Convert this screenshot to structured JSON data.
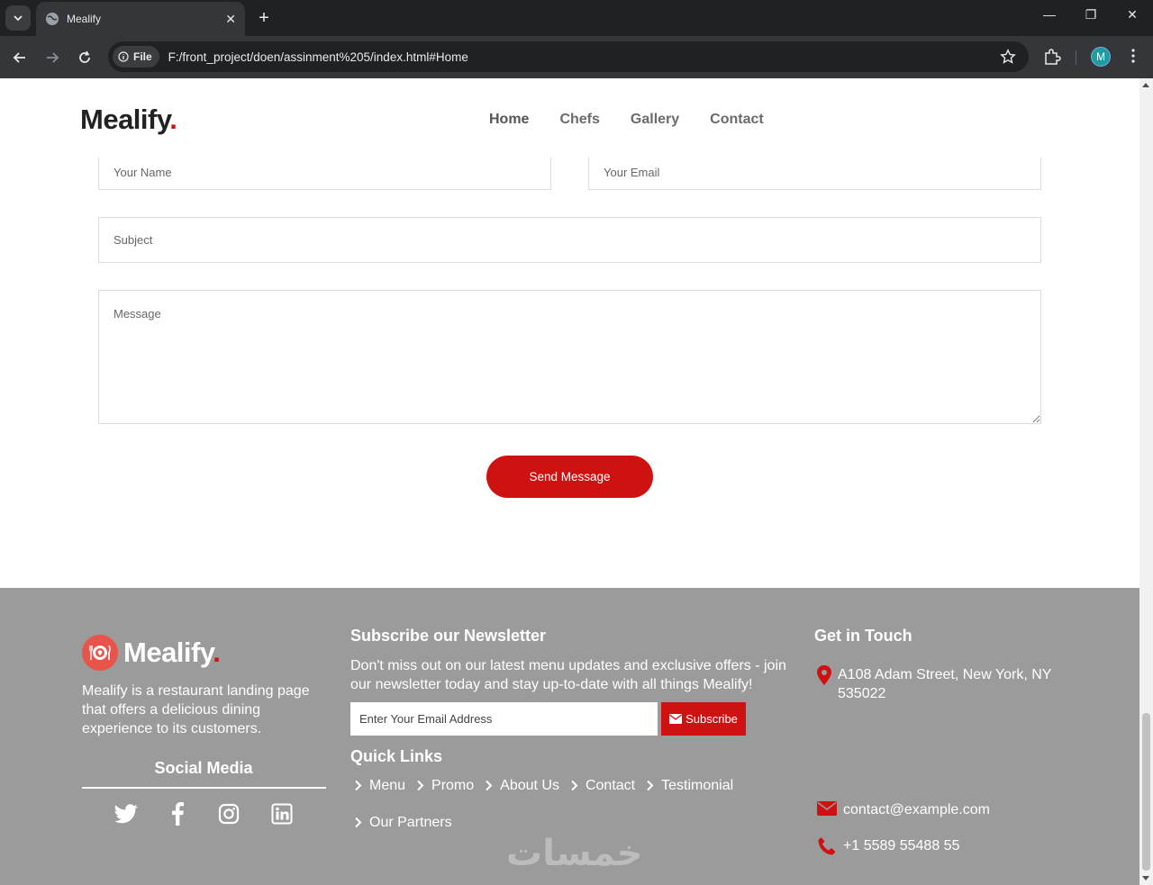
{
  "browser": {
    "tab_title": "Mealify",
    "chip_label": "File",
    "url": "F:/front_project/doen/assinment%205/index.html#Home",
    "profile_initial": "M"
  },
  "header": {
    "logo": "Mealify",
    "logo_dot": ".",
    "nav": [
      "Home",
      "Chefs",
      "Gallery",
      "Contact"
    ]
  },
  "form": {
    "name_placeholder": "Your Name",
    "email_placeholder": "Your Email",
    "subject_placeholder": "Subject",
    "message_placeholder": "Message",
    "send_label": "Send Message"
  },
  "footer": {
    "logo": "Mealify",
    "logo_dot": ".",
    "description": "Mealify is a restaurant landing page that offers a delicious dining experience to its customers.",
    "social_title": "Social Media",
    "social_icons": [
      "twitter-icon",
      "facebook-icon",
      "instagram-icon",
      "linkedin-icon"
    ],
    "newsletter_title": "Subscribe our Newsletter",
    "newsletter_desc": "Don't miss out on our latest menu updates and exclusive offers - join our newsletter today and stay up-to-date with all things Mealify!",
    "email_placeholder": "Enter Your Email Address",
    "subscribe_label": "Subscribe",
    "quick_links_title": "Quick Links",
    "quick_links": [
      "Menu",
      "Promo",
      "About Us",
      "Contact",
      "Testimonial",
      "Our Partners"
    ],
    "get_in_touch_title": "Get in Touch",
    "address": "A108 Adam Street, New York, NY 535022",
    "email": "contact@example.com",
    "phone": "+1 5589 55488 55",
    "watermark": "خمسات"
  },
  "colors": {
    "accent": "#ce1212",
    "footer_bg": "#9b9b9b"
  }
}
